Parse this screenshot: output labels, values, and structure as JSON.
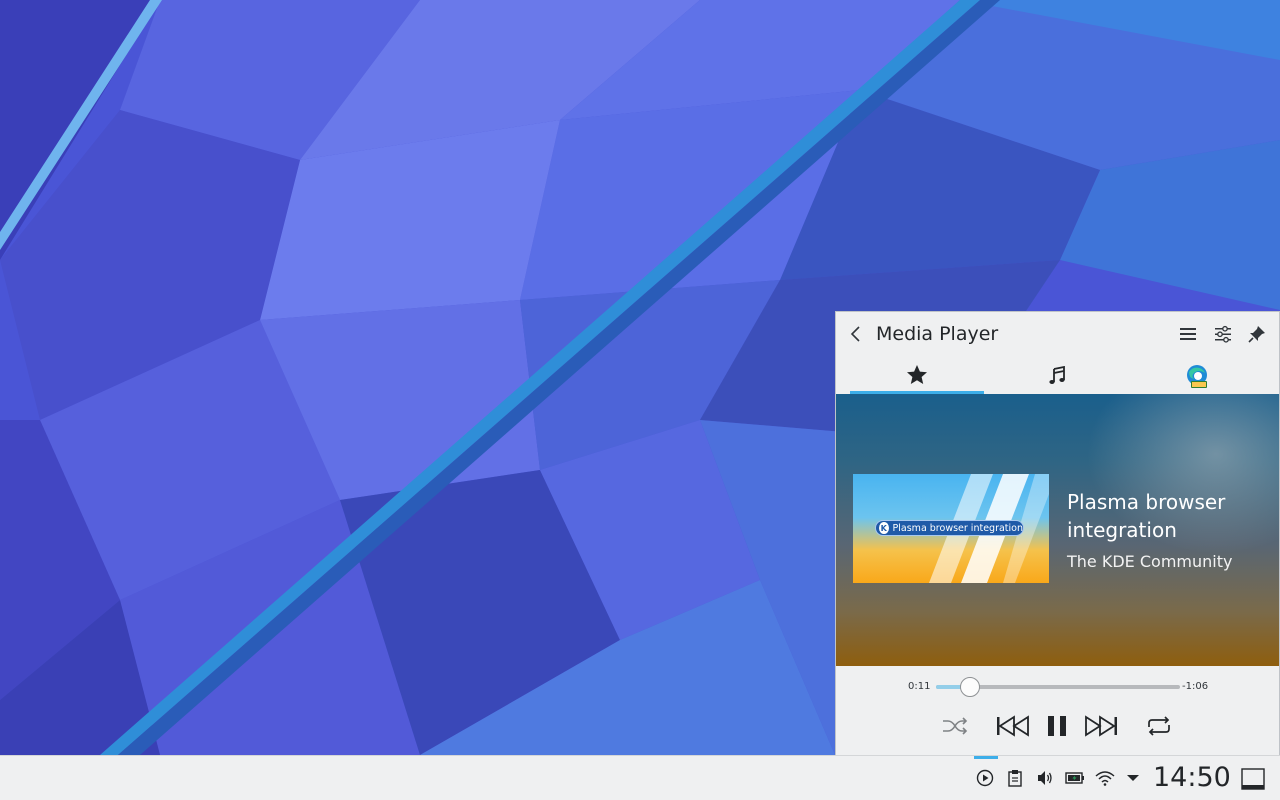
{
  "popup": {
    "title": "Media Player",
    "header_icons": [
      "back-arrow-icon",
      "hamburger-menu-icon",
      "configure-sliders-icon",
      "pin-icon"
    ],
    "tabs": [
      {
        "icon": "star-icon",
        "active": true
      },
      {
        "icon": "music-note-icon",
        "active": false
      },
      {
        "icon": "browser-dev-icon",
        "active": false
      }
    ]
  },
  "now_playing": {
    "title": "Plasma browser integration",
    "artist": "The KDE Community",
    "album_art_text": "Plasma browser integration",
    "album_art_logo": "K"
  },
  "playback": {
    "elapsed": "0:11",
    "remaining": "-1:06",
    "progress": 0.14,
    "state": "playing"
  },
  "taskbar": {
    "clock": "14:50",
    "tray_icons": [
      "media-play-icon",
      "clipboard-icon",
      "volume-icon",
      "battery-icon",
      "wifi-icon",
      "tray-expand-icon"
    ],
    "show_desktop_icon": "show-desktop-icon"
  },
  "colors": {
    "accent": "#3daee9",
    "panel_bg": "#eff0f1",
    "text": "#232629"
  }
}
